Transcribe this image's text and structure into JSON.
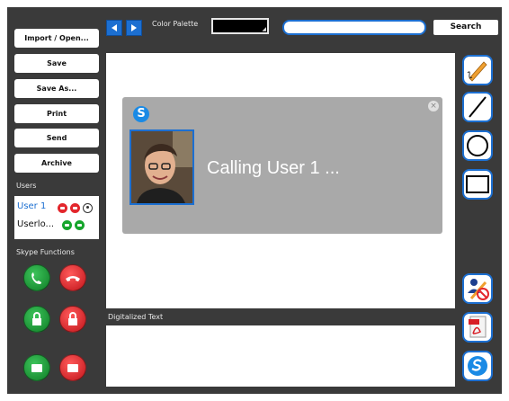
{
  "toolbar": {
    "prev_icon": "triangle-left-icon",
    "next_icon": "triangle-right-icon",
    "palette_label": "Color Palette",
    "current_color": "#000000",
    "search_value": "",
    "search_label": "Search"
  },
  "sidebar": {
    "buttons": [
      {
        "label": "Import / Open..."
      },
      {
        "label": "Save"
      },
      {
        "label": "Save As..."
      },
      {
        "label": "Print"
      },
      {
        "label": "Send"
      },
      {
        "label": "Archive"
      }
    ],
    "users_label": "Users",
    "users": [
      {
        "name": "User 1",
        "color": "#1c6fd1"
      },
      {
        "name": "Userlo...",
        "color": "#111111"
      }
    ],
    "skype_label": "Skype Functions"
  },
  "call": {
    "text": "Calling User 1 ..."
  },
  "digitalized": {
    "label": "Digitalized Text",
    "value": ""
  },
  "colors": {
    "accent": "#1c6fd1",
    "panel": "#3a3a3a",
    "call_bg": "#a9a9a9",
    "green": "#15a52b",
    "red": "#e3262c"
  }
}
